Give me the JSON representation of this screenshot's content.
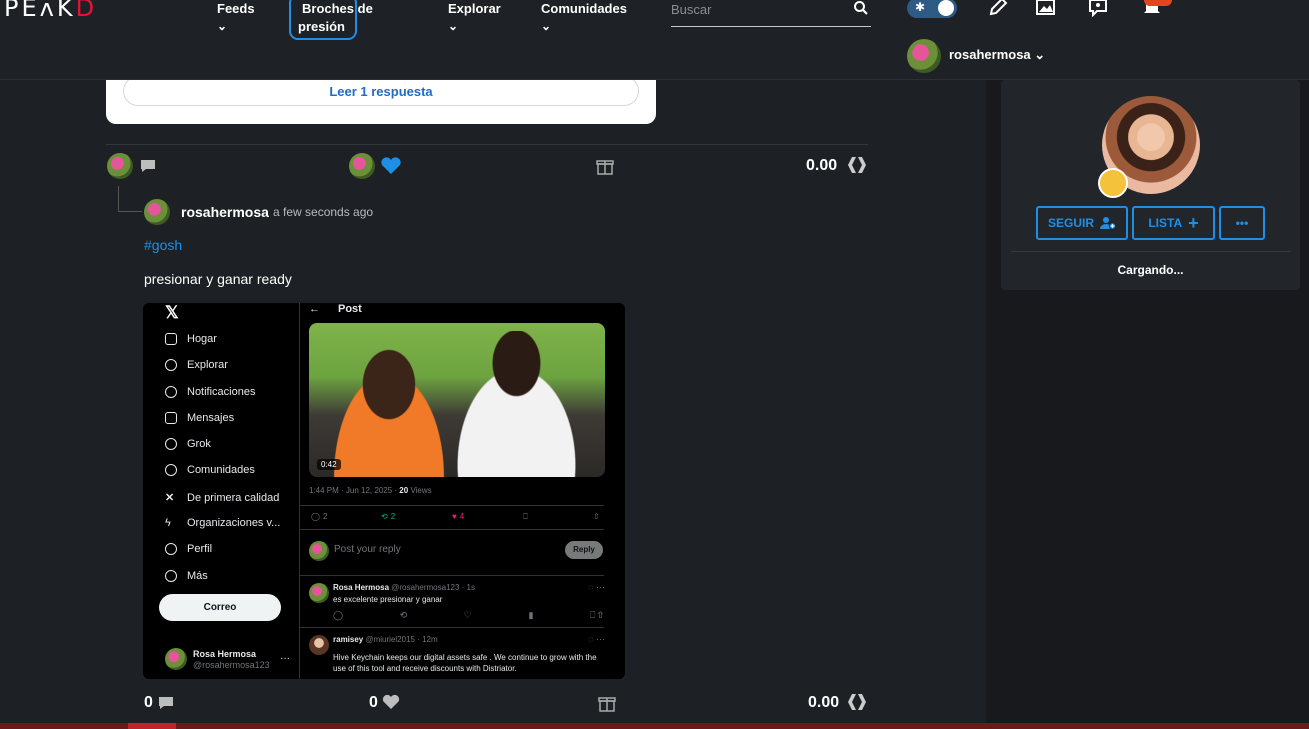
{
  "header": {
    "logo_left": "PE",
    "logo_mid": "ʌK",
    "logo_right": "D",
    "nav": [
      {
        "label": "Feeds"
      },
      {
        "label": "Broches de presión"
      },
      {
        "label": "Explorar"
      },
      {
        "label": "Comunidades"
      }
    ],
    "search_placeholder": "Buscar",
    "username": "rosahermosa",
    "colors": {
      "accent": "#1f8fe6",
      "brand": "#e31337",
      "notification": "#e2461d"
    }
  },
  "previous_comment": {
    "read_reply_label": "Leer 1 respuesta",
    "payout": "0.00"
  },
  "comment": {
    "author": "rosahermosa",
    "time": "a few seconds ago",
    "hashtag": "#gosh",
    "body": "presionar y ganar ready",
    "comments_count": "0",
    "votes_count": "0",
    "payout": "0.00"
  },
  "embedded_screenshot": {
    "nav_items": [
      {
        "label": "Hogar",
        "icon": "home-icon"
      },
      {
        "label": "Explorar",
        "icon": "search-icon"
      },
      {
        "label": "Notificaciones",
        "icon": "bell-icon"
      },
      {
        "label": "Mensajes",
        "icon": "mail-icon"
      },
      {
        "label": "Grok",
        "icon": "grok-icon"
      },
      {
        "label": "Comunidades",
        "icon": "people-icon"
      },
      {
        "label": "De primera calidad",
        "icon": "x-icon"
      },
      {
        "label": "Organizaciones v...",
        "icon": "bolt-icon"
      },
      {
        "label": "Perfil",
        "icon": "person-icon"
      },
      {
        "label": "Más",
        "icon": "more-icon"
      }
    ],
    "post_button": "Correo",
    "me_name": "Rosa Hermosa",
    "me_handle": "@rosahermosa123",
    "page_title": "Post",
    "video_duration": "0:42",
    "meta_time": "1:44 PM · Jun 12, 2025 ·",
    "meta_views_count": "20",
    "meta_views_label": "Views",
    "reply_count": "2",
    "retweet_count": "2",
    "like_count": "4",
    "reply_placeholder": "Post your reply",
    "reply_button": "Reply",
    "tweets": [
      {
        "name": "Rosa Hermosa",
        "handle": "@rosahermosa123 · 1s",
        "text": "es excelente presionar y ganar"
      },
      {
        "name": "ramisey",
        "handle": "@miuriel2015 · 12m",
        "text": "Hive Keychain keeps our digital assets safe  . We continue to grow with the use of this tool and receive discounts with Distriator."
      }
    ]
  },
  "profile": {
    "follow_label": "SEGUIR",
    "list_label": "LISTA",
    "more_label": "•••",
    "loading": "Cargando..."
  }
}
